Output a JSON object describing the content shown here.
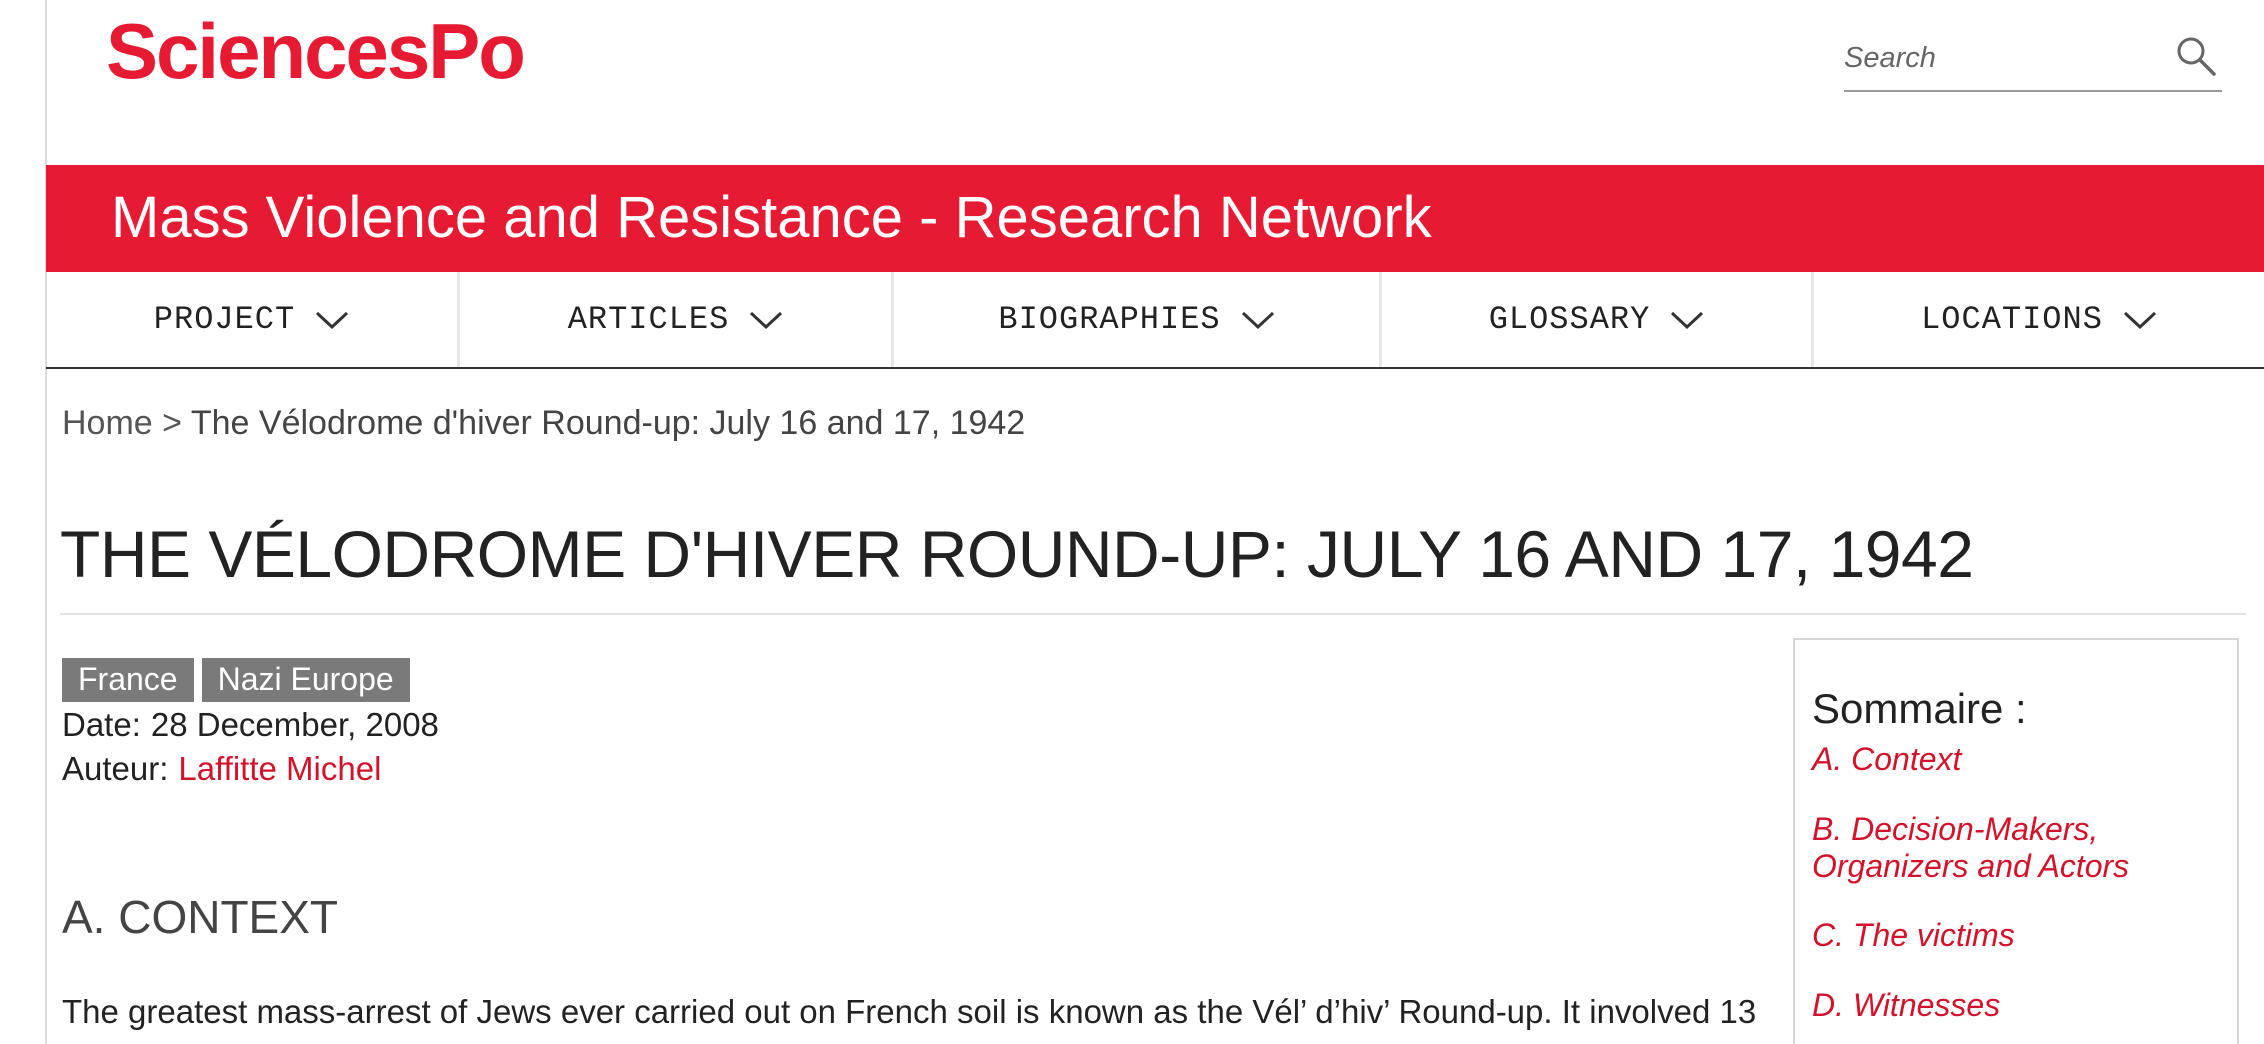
{
  "header": {
    "logo_text": "SciencesPo",
    "search_placeholder": "Search"
  },
  "banner": {
    "title": "Mass Violence and Resistance - Research Network"
  },
  "nav": {
    "items": [
      {
        "label": "PROJECT"
      },
      {
        "label": "ARTICLES"
      },
      {
        "label": "BIOGRAPHIES"
      },
      {
        "label": "GLOSSARY"
      },
      {
        "label": "LOCATIONS"
      }
    ]
  },
  "breadcrumb": {
    "home": "Home",
    "separator": ">",
    "current": "The Vélodrome d'hiver Round-up: July 16 and 17, 1942"
  },
  "article": {
    "title": "THE VÉLODROME D'HIVER ROUND-UP: JULY 16 AND 17, 1942",
    "tags": [
      "France",
      "Nazi Europe"
    ],
    "date_label": "Date:",
    "date_value": "28 December, 2008",
    "author_label": "Auteur:",
    "author_name": "Laffitte Michel",
    "section_heading": "A. CONTEXT",
    "paragraph": "The greatest mass-arrest of Jews ever carried out on French soil is known as the Vél’ d’hiv’ Round-up. It involved 13"
  },
  "sommaire": {
    "title": "Sommaire :",
    "items": [
      "A. Context",
      "B. Decision-Makers, Organizers and Actors",
      "C. The victims",
      "D. Witnesses"
    ]
  },
  "colors": {
    "brand_red": "#e61a32",
    "link_red": "#d3122b",
    "tag_gray": "#7a7a7a"
  }
}
